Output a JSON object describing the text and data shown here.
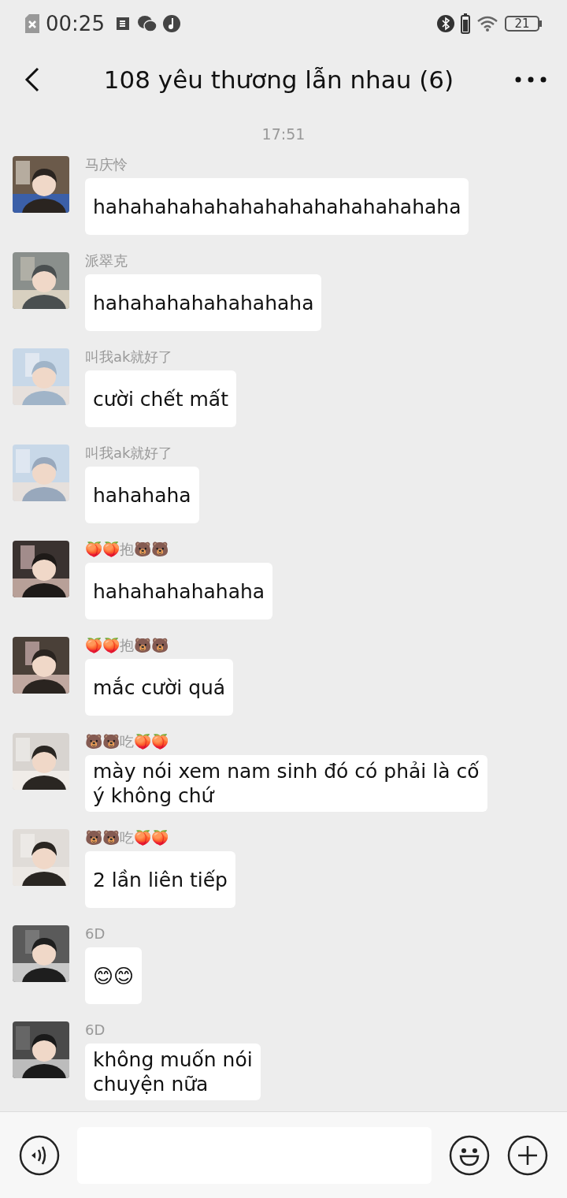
{
  "status_bar": {
    "time": "00:25",
    "battery": "21"
  },
  "header": {
    "title": "108 yêu thương lẫn nhau (6)"
  },
  "timestamp": "17:51",
  "messages": [
    {
      "sender": "马庆怜",
      "text": "hahahahahahahahahahahahahahaha"
    },
    {
      "sender": "派翠克",
      "text": "hahahahahahahahaha"
    },
    {
      "sender": "叫我ak就好了",
      "text": "cười chết mất"
    },
    {
      "sender": "叫我ak就好了",
      "text": "hahahaha"
    },
    {
      "sender": "🍑🍑抱🐻🐻",
      "text": "hahahahahahaha"
    },
    {
      "sender": "🍑🍑抱🐻🐻",
      "text": "mắc cười quá"
    },
    {
      "sender": "🐻🐻吃🍑🍑",
      "text": "mày nói xem nam sinh đó có phải là cố\ný không chứ"
    },
    {
      "sender": "🐻🐻吃🍑🍑",
      "text": "2 lần liên tiếp"
    },
    {
      "sender": "6D",
      "text": "😊😊"
    },
    {
      "sender": "6D",
      "text": "không muốn nói\nchuyện nữa"
    }
  ]
}
